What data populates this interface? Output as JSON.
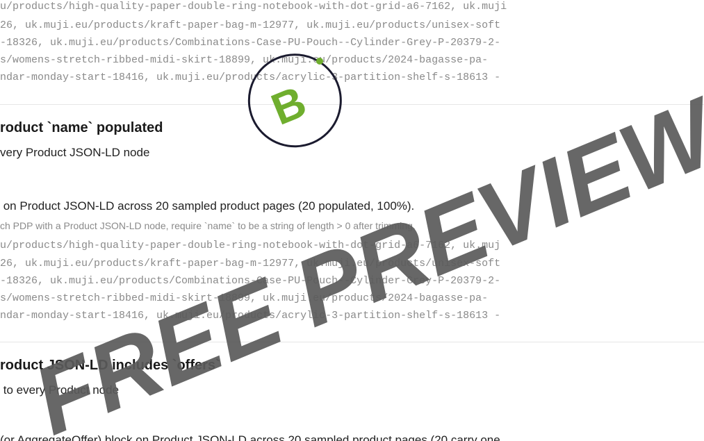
{
  "top_urls": [
    "u/products/high-quality-paper-double-ring-notebook-with-dot-grid-a6-7162, uk.muji",
    "26, uk.muji.eu/products/kraft-paper-bag-m-12977, uk.muji.eu/products/unisex-soft",
    "-18326, uk.muji.eu/products/Combinations-Case-PU-Pouch--Cylinder-Grey-P-20379-2-",
    "s/womens-stretch-ribbed-midi-skirt-18899, uk.muji.eu/products/2024-bagasse-pa-",
    "ndar-monday-start-18416, uk.muji.eu/products/acrylic-3-partition-shelf-s-18613 -"
  ],
  "check_name": {
    "title": "roduct `name` populated",
    "subtitle": "very Product JSON-LD node",
    "summary": " on Product JSON-LD across 20 sampled product pages (20 populated, 100%).",
    "method": "ch PDP with a Product JSON-LD node, require `name` to be a string of length > 0 after trimming.",
    "urls": [
      "u/products/high-quality-paper-double-ring-notebook-with-dot-grid-a6-7162, uk.muj",
      "26, uk.muji.eu/products/kraft-paper-bag-m-12977, uk.muji.eu/products/unisex-soft",
      "-18326, uk.muji.eu/products/Combinations-Case-PU-Pouch--Cylinder-Grey-P-20379-2-",
      "s/womens-stretch-ribbed-midi-skirt-18899, uk.muji.eu/products/2024-bagasse-pa-",
      "ndar-monday-start-18416, uk.muji.eu/products/acrylic-3-partition-shelf-s-18613 -"
    ]
  },
  "check_offers": {
    "title": "roduct JSON-LD includes `offers`",
    "subtitle": " to every Product node",
    "summary": "(or AggregateOffer) block on Product JSON-LD across 20 sampled product pages (20 carry one"
  },
  "watermark": {
    "text": "FREE PREVIEW",
    "badge_letter": "B",
    "text_color": "#5b5b5b",
    "badge_color": "#6fae2e",
    "ring_color": "#1b1b2f"
  }
}
